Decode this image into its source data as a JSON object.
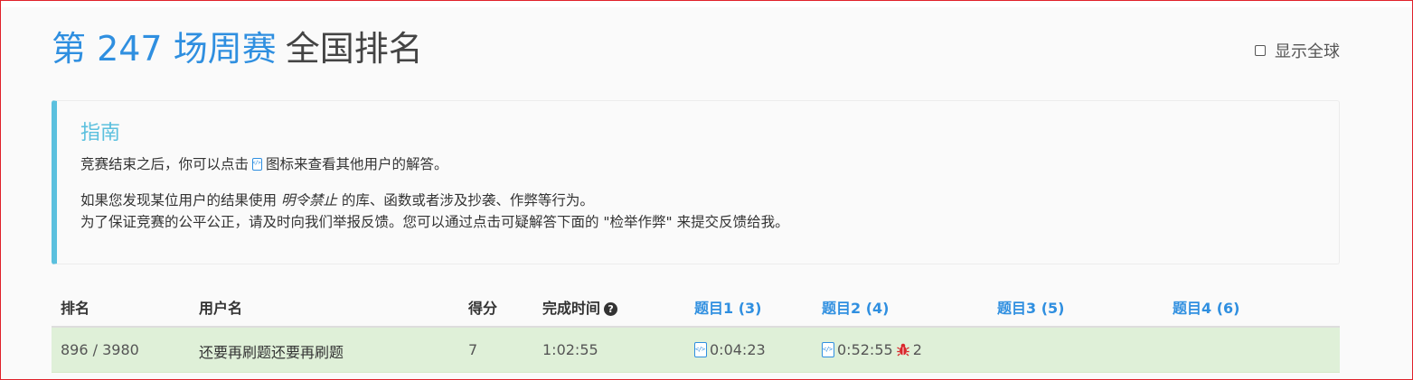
{
  "header": {
    "title_accent": "第 247 场周赛",
    "title_rest": "全国排名",
    "global_toggle_label": "显示全球"
  },
  "guide": {
    "title": "指南",
    "line1_before": "竞赛结束之后，你可以点击",
    "line1_after": "图标来查看其他用户的解答。",
    "line2_before": "如果您发现某位用户的结果使用",
    "line2_italic": "明令禁止",
    "line2_after": "的库、函数或者涉及抄袭、作弊等行为。",
    "line3": "为了保证竞赛的公平公正，请及时向我们举报反馈。您可以通过点击可疑解答下面的 \"检举作弊\" 来提交反馈给我。"
  },
  "table": {
    "headers": {
      "rank": "排名",
      "username": "用户名",
      "score": "得分",
      "finish_time": "完成时间",
      "q1": "题目1 (3)",
      "q2": "题目2 (4)",
      "q3": "题目3 (5)",
      "q4": "题目4 (6)"
    },
    "rows": [
      {
        "rank": "896 / 3980",
        "username": "还要再刷题还要再刷题",
        "score": "7",
        "finish_time": "1:02:55",
        "q1": "0:04:23",
        "q2": "0:52:55",
        "q2_wrong_count": "2",
        "q3": "",
        "q4": ""
      }
    ]
  },
  "icons": {
    "code": "code-file-icon",
    "help": "question-circle-icon",
    "bug": "bug-icon"
  },
  "colors": {
    "accent": "#2f8fe0",
    "guide_border": "#5bc0de",
    "row_success": "#dff0d8",
    "bug": "#d9262b"
  }
}
